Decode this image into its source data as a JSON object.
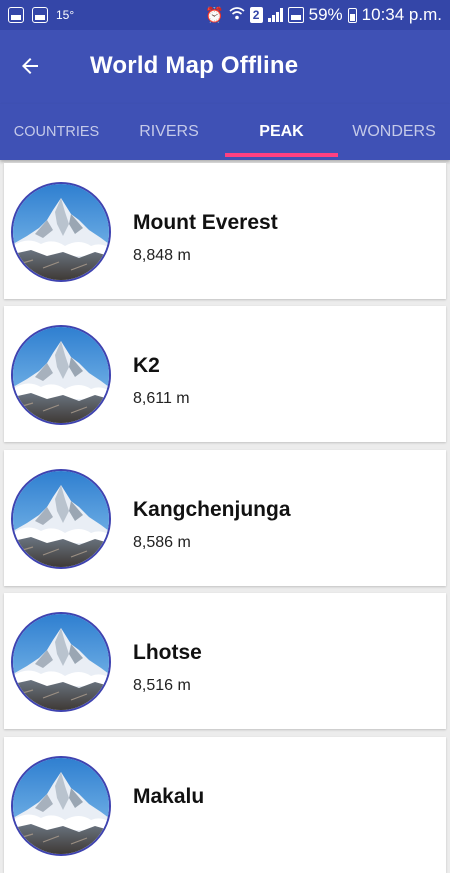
{
  "status_bar": {
    "temperature": "15°",
    "sim_slot": "2",
    "battery_percent": "59%",
    "time": "10:34 p.m.",
    "icons": [
      "gallery-icon",
      "image-icon",
      "alarm-icon",
      "wifi-icon",
      "signal-icon",
      "battery-icon"
    ]
  },
  "appbar": {
    "title": "World Map Offline",
    "back_icon": "arrow-left-icon"
  },
  "tabs": [
    {
      "label": "COUNTRIES",
      "active": false
    },
    {
      "label": "RIVERS",
      "active": false
    },
    {
      "label": "PEAK",
      "active": true
    },
    {
      "label": "WONDERS",
      "active": false
    }
  ],
  "colors": {
    "primary": "#3f51b5",
    "primary_dark": "#3446a8",
    "accent": "#ff4081"
  },
  "peaks": [
    {
      "name": "Mount Everest",
      "height": "8,848 m"
    },
    {
      "name": "K2",
      "height": "8,611 m"
    },
    {
      "name": "Kangchenjunga",
      "height": "8,586 m"
    },
    {
      "name": "Lhotse",
      "height": "8,516 m"
    },
    {
      "name": "Makalu",
      "height": ""
    }
  ]
}
